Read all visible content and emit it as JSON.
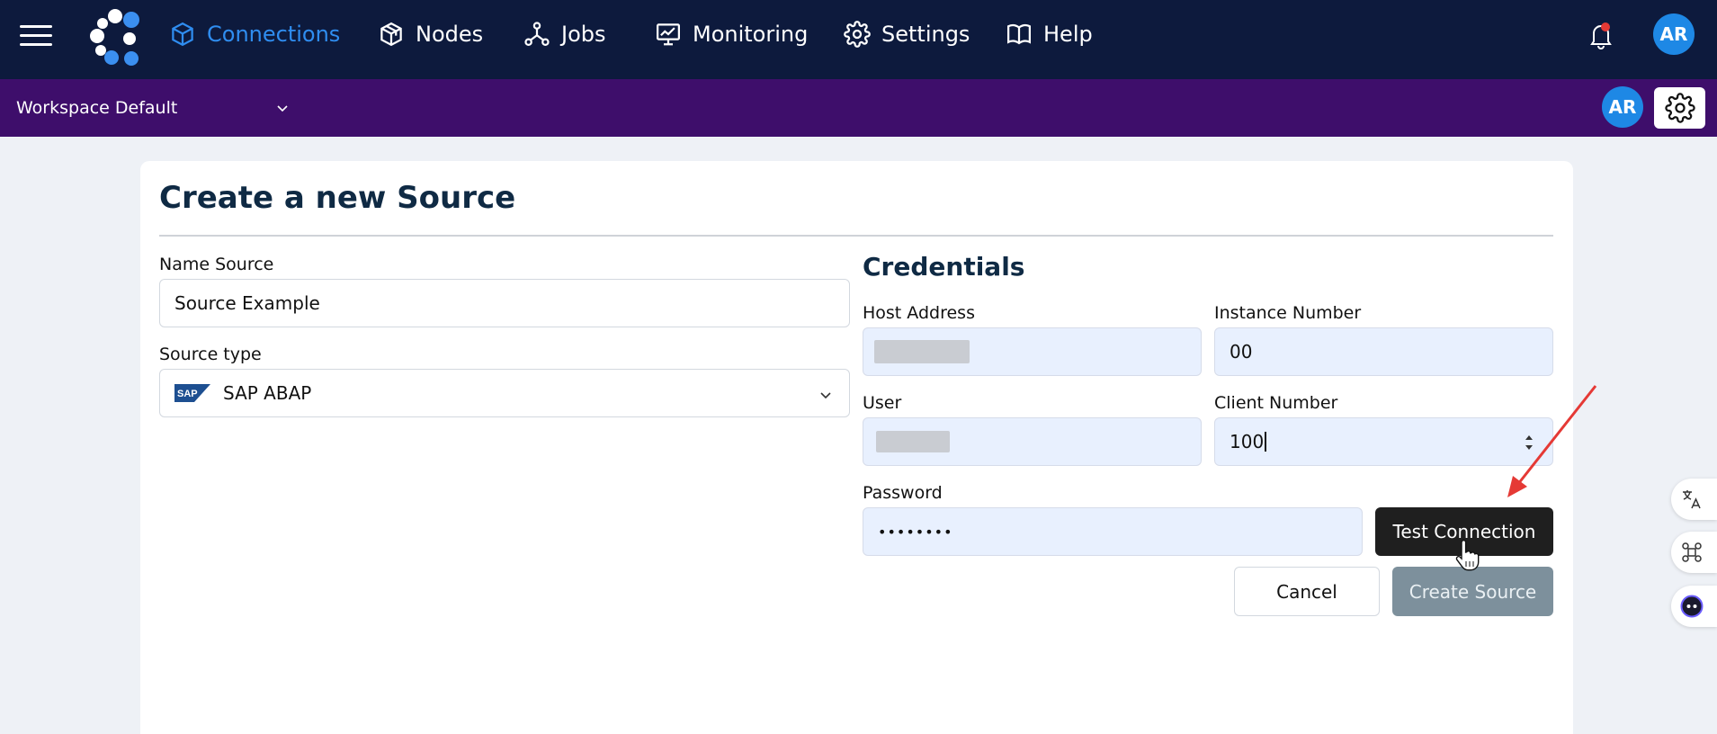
{
  "nav": {
    "items": [
      {
        "label": "Connections",
        "icon": "cube-icon",
        "active": true
      },
      {
        "label": "Nodes",
        "icon": "boxes-icon",
        "active": false
      },
      {
        "label": "Jobs",
        "icon": "network-icon",
        "active": false
      },
      {
        "label": "Monitoring",
        "icon": "monitor-chart-icon",
        "active": false
      },
      {
        "label": "Settings",
        "icon": "gear-icon",
        "active": false
      },
      {
        "label": "Help",
        "icon": "book-icon",
        "active": false
      }
    ],
    "avatar_initials": "AR",
    "active_color": "#2f8df0",
    "background_color": "#0d1a3d"
  },
  "workspace": {
    "label": "Workspace Default",
    "avatar_initials": "AR",
    "background_color": "#3e0e6b"
  },
  "page": {
    "title": "Create a new Source"
  },
  "form": {
    "name_label": "Name Source",
    "name_value": "Source Example",
    "source_type_label": "Source type",
    "source_type_value": "SAP ABAP",
    "source_type_logo_text": "SAP"
  },
  "credentials": {
    "title": "Credentials",
    "host_label": "Host Address",
    "instance_label": "Instance Number",
    "instance_value": "00",
    "user_label": "User",
    "client_label": "Client Number",
    "client_value": "100",
    "password_label": "Password",
    "password_value": "••••••••"
  },
  "actions": {
    "test_connection": "Test Connection",
    "cancel": "Cancel",
    "create_source": "Create Source"
  },
  "annotation": {
    "arrow_color": "#e53935"
  }
}
